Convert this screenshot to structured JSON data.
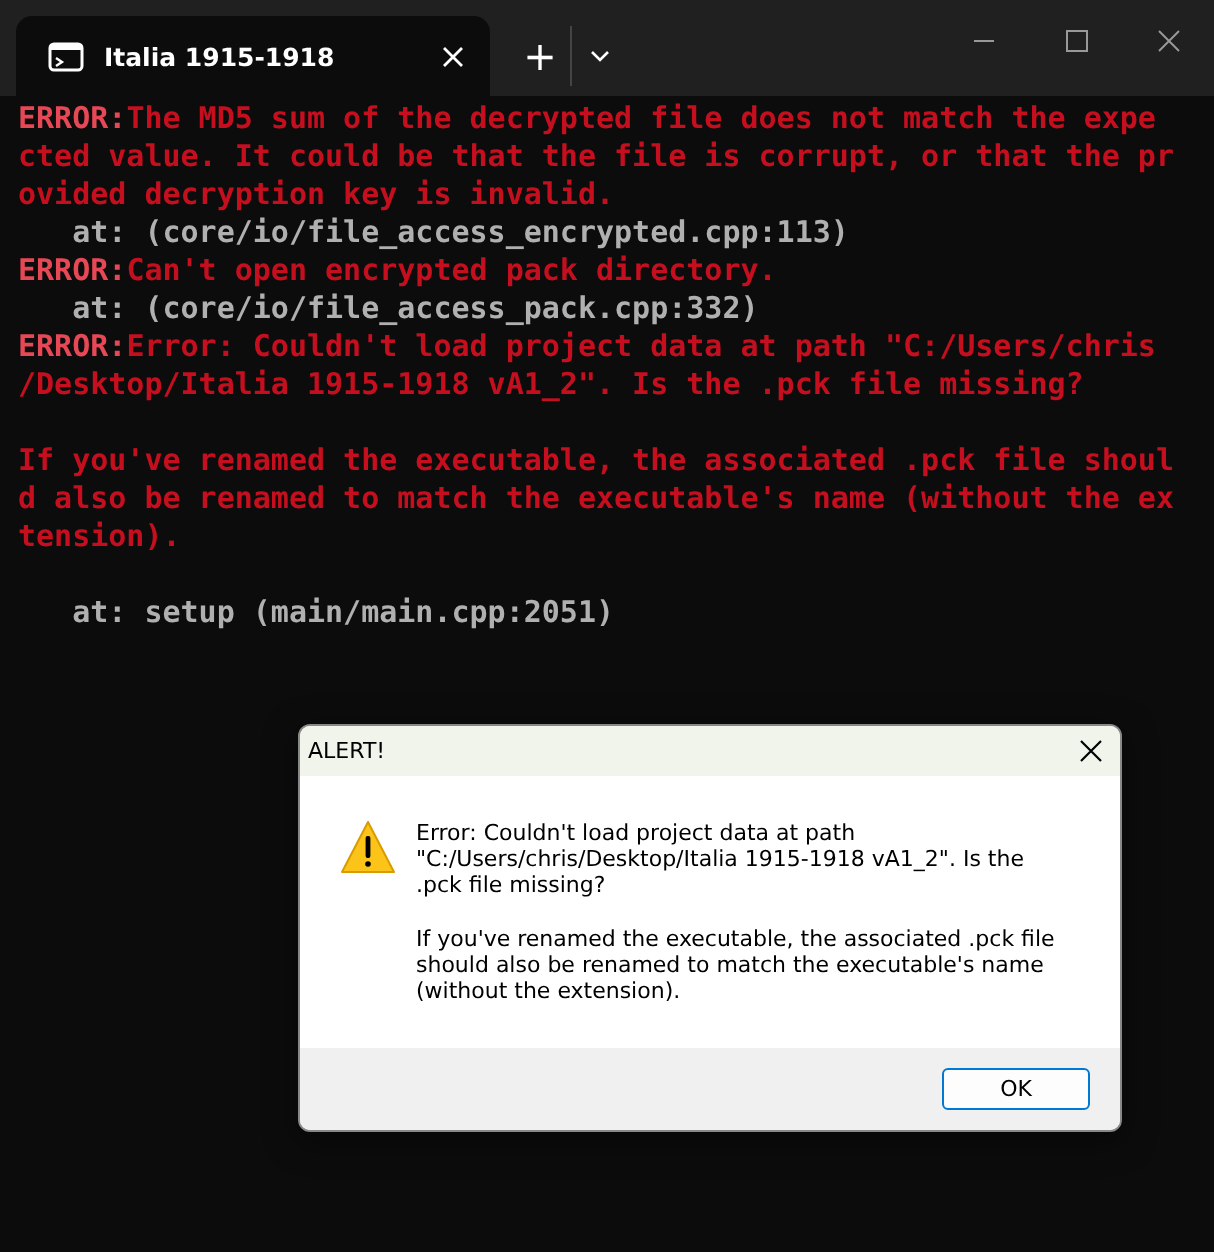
{
  "window": {
    "tab_title": "Italia 1915-1918",
    "new_tab": "+"
  },
  "terminal": {
    "lines": [
      {
        "kind": "error",
        "label": "ERROR:",
        "text": "The MD5 sum of the decrypted file does not match the expe"
      },
      {
        "kind": "message",
        "text": "cted value. It could be that the file is corrupt, or that the pr"
      },
      {
        "kind": "message",
        "text": "ovided decryption key is invalid."
      },
      {
        "kind": "trace",
        "text": "   at: (core/io/file_access_encrypted.cpp:113)"
      },
      {
        "kind": "error",
        "label": "ERROR:",
        "text": "Can't open encrypted pack directory."
      },
      {
        "kind": "trace",
        "text": "   at: (core/io/file_access_pack.cpp:332)"
      },
      {
        "kind": "error",
        "label": "ERROR:",
        "text": "Error: Couldn't load project data at path \"C:/Users/chris"
      },
      {
        "kind": "message",
        "text": "/Desktop/Italia 1915-1918 vA1_2\". Is the .pck file missing?"
      },
      {
        "kind": "blank"
      },
      {
        "kind": "message",
        "text": "If you've renamed the executable, the associated .pck file shoul"
      },
      {
        "kind": "message",
        "text": "d also be renamed to match the executable's name (without the ex"
      },
      {
        "kind": "message",
        "text": "tension)."
      },
      {
        "kind": "blank"
      },
      {
        "kind": "trace",
        "text": "   at: setup (main/main.cpp:2051)"
      }
    ]
  },
  "dialog": {
    "title": "ALERT!",
    "paragraphs": [
      "Error: Couldn't load project data at path \"C:/Users/chris/Desktop/Italia 1915-1918 vA1_2\". Is the .pck file missing?",
      "If you've renamed the executable, the associated .pck file should also be renamed to match the executable's name (without the extension)."
    ],
    "button": "OK"
  }
}
